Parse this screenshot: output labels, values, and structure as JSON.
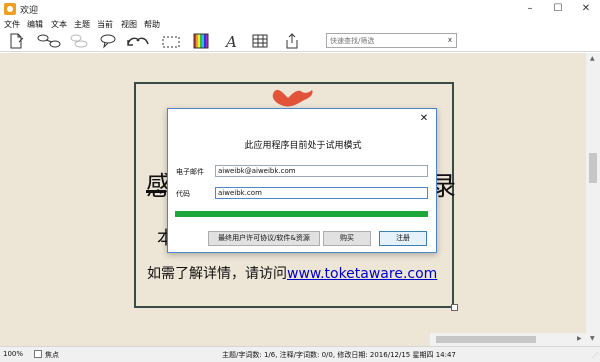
{
  "window": {
    "title": "欢迎",
    "minimize": "–",
    "maximize": "☐",
    "close": "✕"
  },
  "menu": [
    "文件",
    "编辑",
    "文本",
    "主题",
    "当前",
    "视图",
    "帮助"
  ],
  "toolbar": {
    "tools": [
      "new-document-icon",
      "link-topics-icon",
      "group-topics-icon",
      "callout-icon",
      "undo-icon",
      "redo-icon",
      "boundary-icon",
      "color-icon",
      "font-icon",
      "table-icon",
      "export-icon"
    ],
    "search_placeholder": "快速查找/筛选",
    "search_clear": "x"
  },
  "canvas": {
    "bg_text_left": "感",
    "bg_text_right": "录",
    "bg_text_small": "本",
    "visit_prefix": "如需了解详情，请访问",
    "visit_link": "www.toketaware.com"
  },
  "dialog": {
    "close": "✕",
    "title": "此应用程序目前处于试用模式",
    "email_label": "电子邮件",
    "email_value": "aiweibk@aiweibk.com",
    "code_label": "代码",
    "code_value": "aiweibk.com",
    "progress": 1.0,
    "buttons": {
      "eula": "最终用户许可协议/软件&资源",
      "buy": "购买",
      "register": "注册"
    }
  },
  "status": {
    "zoom": "100%",
    "focus_label": "焦点",
    "info": "主题/字词数: 1/6, 注释/字词数: 0/0, 修改日期: 2016/12/15 星期四 14:47"
  },
  "colors": {
    "progress": "#1ea83c",
    "canvas_bg": "#ede5d6",
    "link": "#0000cc",
    "app_icon": "#f0a020"
  }
}
